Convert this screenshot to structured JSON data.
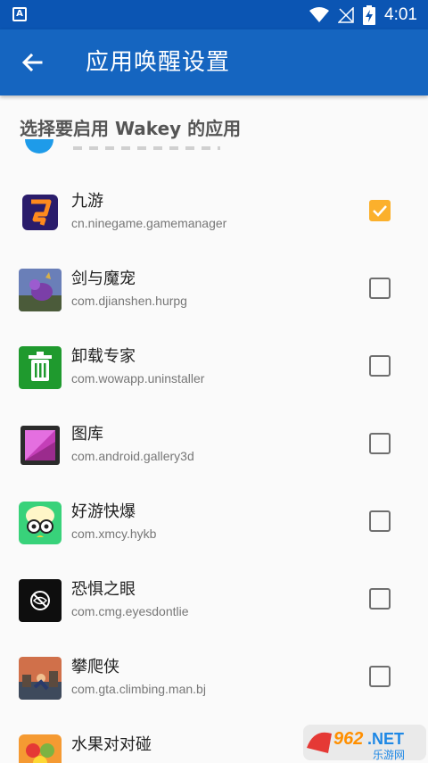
{
  "status_bar": {
    "time": "4:01",
    "notification_icon": "A"
  },
  "app_bar": {
    "title": "应用唤醒设置",
    "back_icon": "arrow-left-icon"
  },
  "section_header": "选择要启用 Wakey 的应用",
  "apps": [
    {
      "name": "九游",
      "package": "cn.ninegame.gamemanager",
      "checked": true
    },
    {
      "name": "剑与魔宠",
      "package": "com.djianshen.hurpg",
      "checked": false
    },
    {
      "name": "卸载专家",
      "package": "com.wowapp.uninstaller",
      "checked": false
    },
    {
      "name": "图库",
      "package": "com.android.gallery3d",
      "checked": false
    },
    {
      "name": "好游快爆",
      "package": "com.xmcy.hykb",
      "checked": false
    },
    {
      "name": "恐惧之眼",
      "package": "com.cmg.eyesdontlie",
      "checked": false
    },
    {
      "name": "攀爬侠",
      "package": "com.gta.climbing.man.bj",
      "checked": false
    },
    {
      "name": "水果对对碰",
      "package": "",
      "checked": false
    }
  ],
  "watermark": {
    "brand": "962.NET",
    "sub": "乐游网"
  },
  "colors": {
    "status_bar": "#0b55b3",
    "app_bar": "#1565c0",
    "checked": "#fbb02c"
  }
}
